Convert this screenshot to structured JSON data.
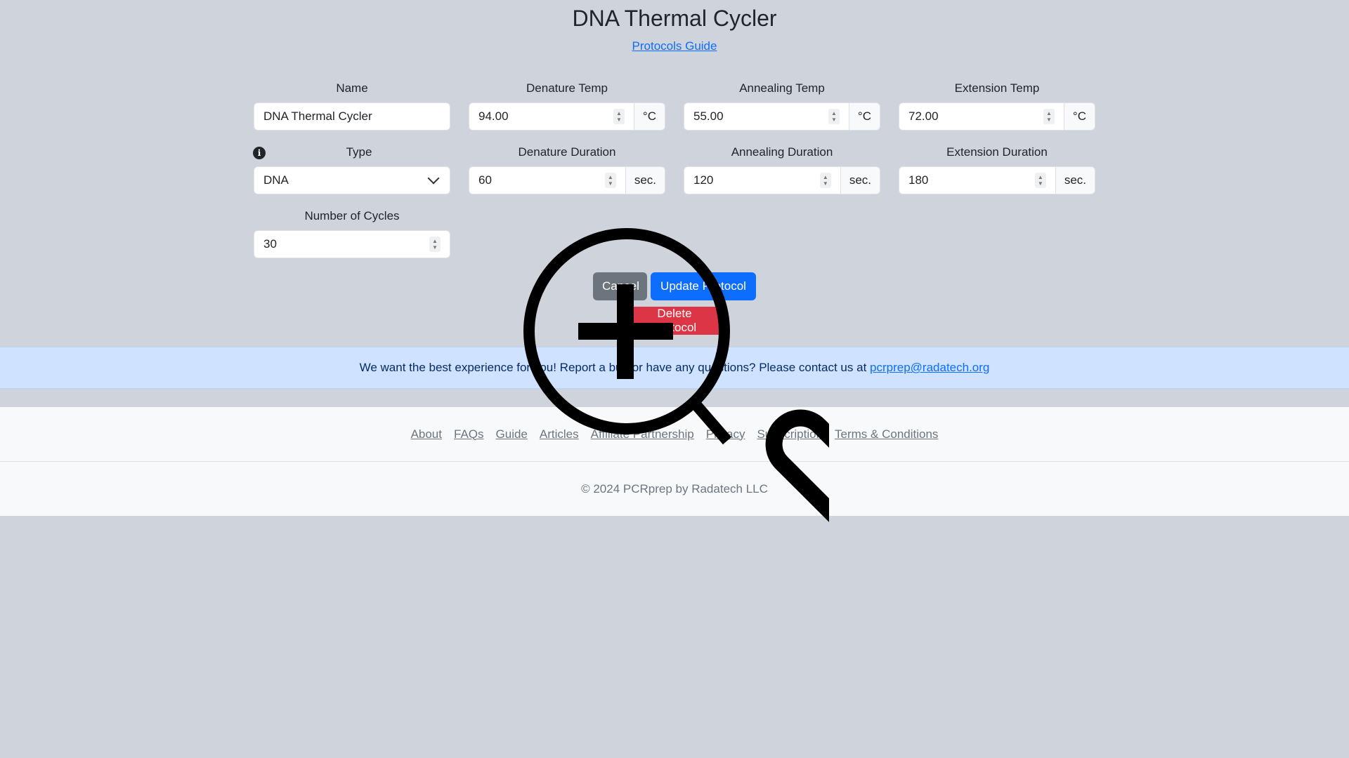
{
  "header": {
    "title": "DNA Thermal Cycler",
    "guide_link": "Protocols Guide"
  },
  "form": {
    "name": {
      "label": "Name",
      "value": "DNA Thermal Cycler"
    },
    "denature_temp": {
      "label": "Denature Temp",
      "value": "94.00",
      "unit": "°C"
    },
    "annealing_temp": {
      "label": "Annealing Temp",
      "value": "55.00",
      "unit": "°C"
    },
    "extension_temp": {
      "label": "Extension Temp",
      "value": "72.00",
      "unit": "°C"
    },
    "type": {
      "label": "Type",
      "value": "DNA",
      "info_icon": "info-icon"
    },
    "denature_duration": {
      "label": "Denature Duration",
      "value": "60",
      "unit": "sec."
    },
    "annealing_duration": {
      "label": "Annealing Duration",
      "value": "120",
      "unit": "sec."
    },
    "extension_duration": {
      "label": "Extension Duration",
      "value": "180",
      "unit": "sec."
    },
    "cycles": {
      "label": "Number of Cycles",
      "value": "30"
    }
  },
  "actions": {
    "cancel": "Cancel",
    "update": "Update Protocol",
    "delete": "Delete Protocol"
  },
  "feedback": {
    "text": "We want the best experience for you! Report a bug or have any questions? Please contact us at ",
    "email": "pcrprep@radatech.org"
  },
  "footer": {
    "links": [
      "About",
      "FAQs",
      "Guide",
      "Articles",
      "Affiliate Partnership",
      "Privacy",
      "Subscription",
      "Terms & Conditions"
    ],
    "copyright": "© 2024 PCRprep by Radatech LLC"
  },
  "overlay": {
    "icon": "zoom-in-magnifier-icon"
  },
  "colors": {
    "background": "#cfd4dc",
    "primary": "#0d6efd",
    "secondary": "#6c757d",
    "danger": "#dc3545",
    "banner": "#cfe2ff"
  }
}
